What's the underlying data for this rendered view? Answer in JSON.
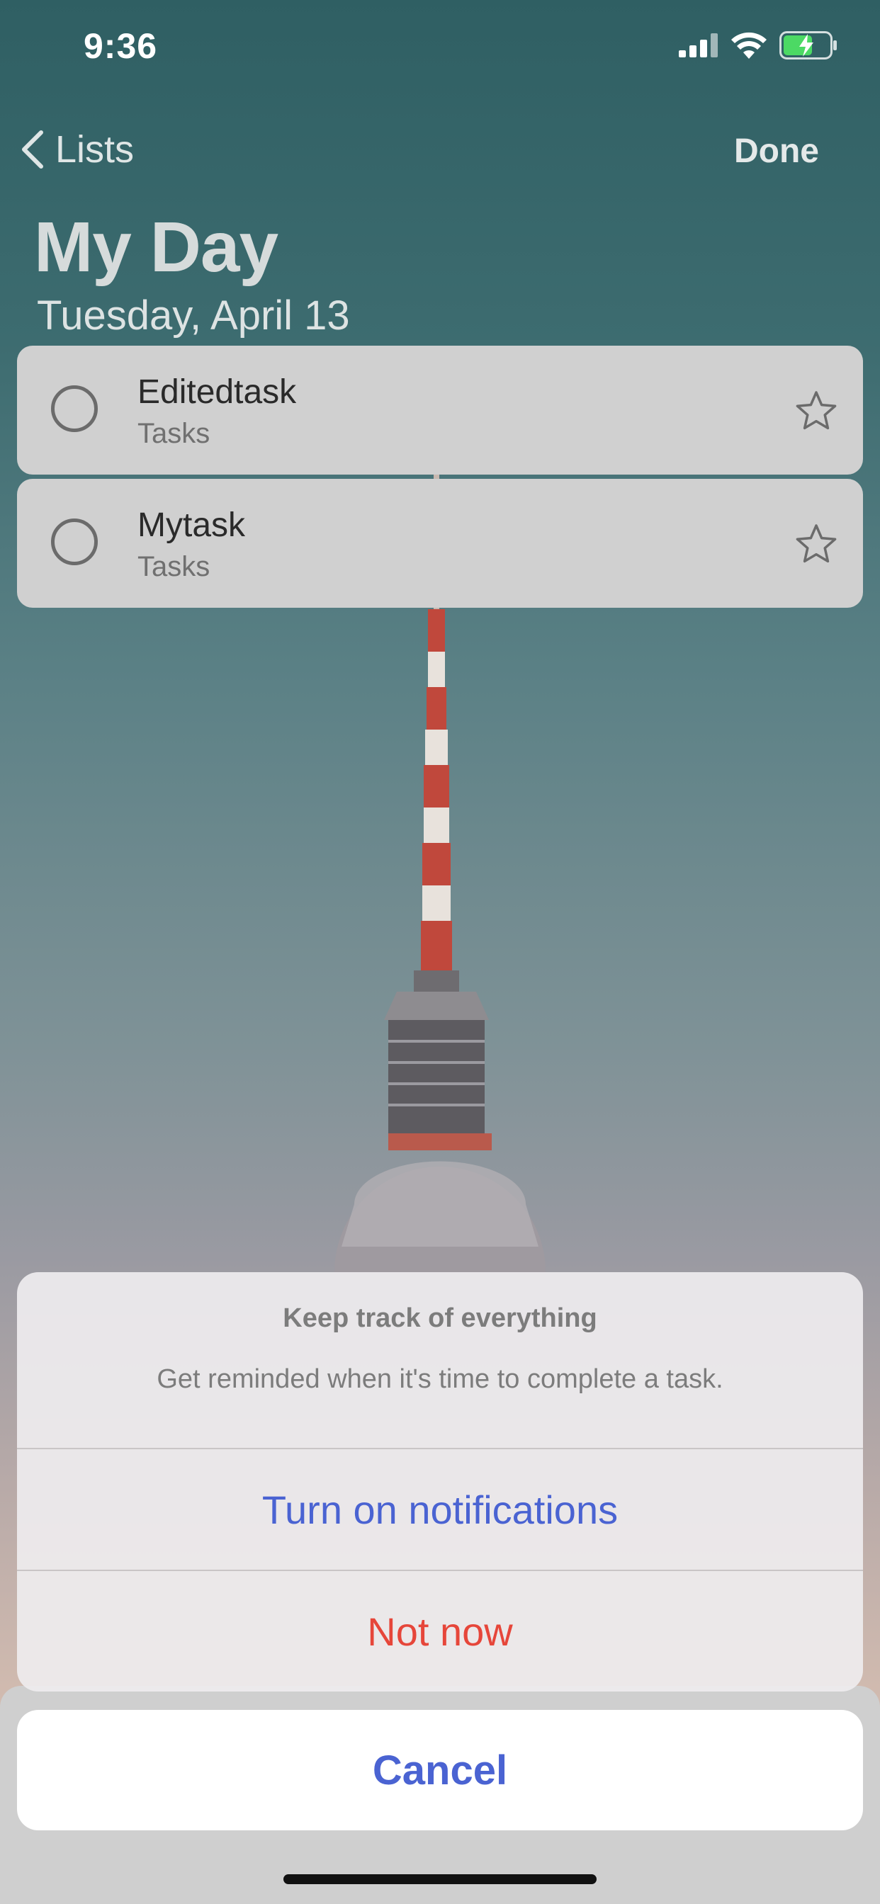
{
  "status_bar": {
    "time": "9:36",
    "battery_icon": "battery-charging-icon",
    "wifi_icon": "wifi-icon",
    "signal_icon": "cellular-signal-icon"
  },
  "nav": {
    "back_label": "Lists",
    "done_label": "Done"
  },
  "header": {
    "title": "My Day",
    "date": "Tuesday, April 13"
  },
  "tasks": [
    {
      "title": "Editedtask",
      "list": "Tasks"
    },
    {
      "title": "Mytask",
      "list": "Tasks"
    }
  ],
  "alert": {
    "title": "Keep track of everything",
    "message": "Get reminded when it's time to complete a task.",
    "primary_action": "Turn on notifications",
    "secondary_action": "Not now"
  },
  "cancel_label": "Cancel",
  "colors": {
    "accent": "#4a63d2",
    "destructive": "#e6463a",
    "battery_green": "#4cd964"
  }
}
